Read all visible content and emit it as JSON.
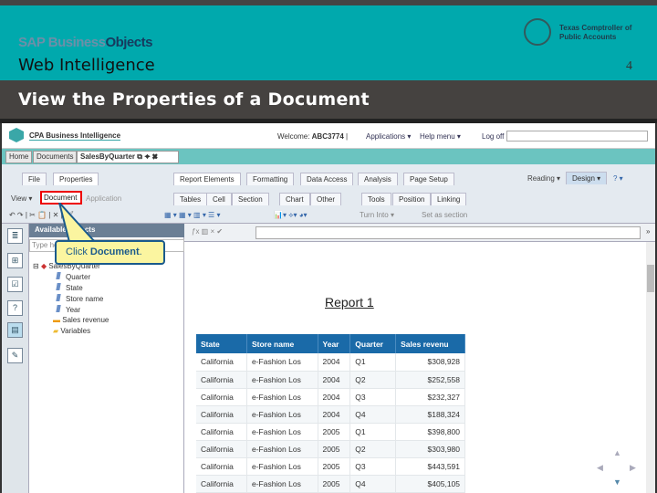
{
  "slide": {
    "brand": "SAP Business",
    "brand_bold": "Objects",
    "product": "Web Intelligence",
    "org_line1": "Texas Comptroller of",
    "org_line2": "Public Accounts",
    "page_number": "4",
    "title": "View the Properties of a Document"
  },
  "app": {
    "name": "CPA Business Intelligence",
    "welcome": "Welcome:",
    "user": "ABC3774",
    "applications": "Applications ▾",
    "help": "Help menu ▾",
    "logoff": "Log off",
    "doc_tabs": [
      "Home",
      "Documents",
      "SalesByQuarter"
    ],
    "left_tabs": [
      "File",
      "Properties"
    ],
    "left_buttons": [
      "View ▾",
      "Document",
      "Application"
    ],
    "main_tabs": [
      "Report Elements",
      "Formatting",
      "Data Access",
      "Analysis",
      "Page Setup"
    ],
    "sub_tabs": [
      "Tables",
      "Cell",
      "Section",
      "Chart",
      "Other",
      "Tools",
      "Position",
      "Linking"
    ],
    "tools": [
      "Turn Into ▾",
      "Set as section"
    ],
    "modes": [
      "Reading ▾",
      "Design ▾",
      "? ▾"
    ],
    "panel_title": "Available Objects",
    "type_placeholder": "Type here",
    "tree_root": "SalesByQuarter",
    "tree_items": [
      "Quarter",
      "State",
      "Store name",
      "Year"
    ],
    "measure": "Sales revenue",
    "variables": "Variables",
    "report_title": "Report 1"
  },
  "callout": {
    "prefix": "Click ",
    "bold": "Document",
    "suffix": "."
  },
  "table": {
    "headers": [
      "State",
      "Store name",
      "Year",
      "Quarter",
      "Sales revenu"
    ],
    "rows": [
      [
        "California",
        "e-Fashion Los",
        "2004",
        "Q1",
        "$308,928"
      ],
      [
        "California",
        "e-Fashion Los",
        "2004",
        "Q2",
        "$252,558"
      ],
      [
        "California",
        "e-Fashion Los",
        "2004",
        "Q3",
        "$232,327"
      ],
      [
        "California",
        "e-Fashion Los",
        "2004",
        "Q4",
        "$188,324"
      ],
      [
        "California",
        "e-Fashion Los",
        "2005",
        "Q1",
        "$398,800"
      ],
      [
        "California",
        "e-Fashion Los",
        "2005",
        "Q2",
        "$303,980"
      ],
      [
        "California",
        "e-Fashion Los",
        "2005",
        "Q3",
        "$443,591"
      ],
      [
        "California",
        "e-Fashion Los",
        "2005",
        "Q4",
        "$405,105"
      ]
    ]
  }
}
